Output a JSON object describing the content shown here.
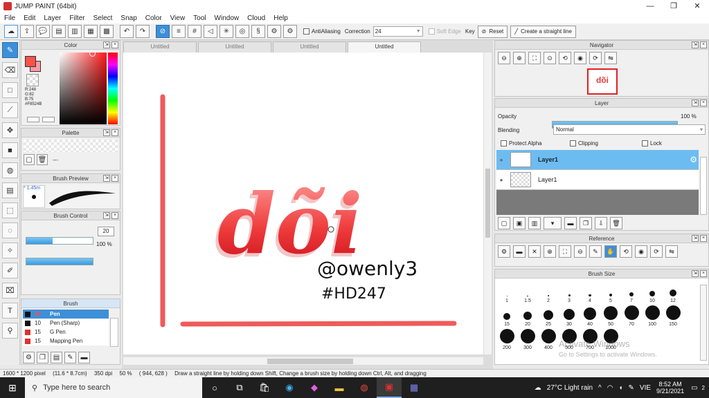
{
  "window": {
    "title": "JUMP PAINT (64bit)",
    "minimize": "—",
    "maximize": "❐",
    "close": "✕"
  },
  "menu": [
    "File",
    "Edit",
    "Layer",
    "Filter",
    "Select",
    "Snap",
    "Color",
    "View",
    "Tool",
    "Window",
    "Cloud",
    "Help"
  ],
  "toolbar": {
    "antialiasing_label": "AntiAliasing",
    "correction_label": "Correction",
    "correction_value": "24",
    "softedge_label": "Soft Edge",
    "key_label": "Key",
    "reset_label": "Reset",
    "straight_line_label": "Create a straight line"
  },
  "color_panel": {
    "title": "Color",
    "r": "R:248",
    "g": "G:82",
    "b": "B:75",
    "hex": "#F8524B",
    "accent": "#f8524b"
  },
  "palette_panel": {
    "title": "Palette",
    "dash": "---"
  },
  "brush_preview_panel": {
    "title": "Brush Preview",
    "size_label": "* 1.45m"
  },
  "brush_control_panel": {
    "title": "Brush Control",
    "size_value": "20",
    "opacity_value": "100 %",
    "size_fraction": 0.4,
    "opacity_fraction": 1.0
  },
  "brush_panel": {
    "title": "Brush",
    "items": [
      {
        "size": "20",
        "name": "Pen",
        "selected": true
      },
      {
        "size": "10",
        "name": "Pen (Sharp)",
        "selected": false
      },
      {
        "size": "15",
        "name": "G Pen",
        "selected": false
      },
      {
        "size": "15",
        "name": "Mapping Pen",
        "selected": false
      }
    ]
  },
  "doc_tabs": [
    "Untitled",
    "Untitled",
    "Untitled",
    "Untitled"
  ],
  "artwork": {
    "word": "dõi",
    "handle": "@owenly3",
    "tag": "#HD247",
    "stroke_color": "#f05050"
  },
  "navigator_panel": {
    "title": "Navigator"
  },
  "layer_panel": {
    "title": "Layer",
    "opacity_label": "Opacity",
    "opacity_value": "100 %",
    "opacity_fraction": 1.0,
    "blending_label": "Blending",
    "blending_value": "Normal",
    "protect_alpha_label": "Protect Alpha",
    "clipping_label": "Clipping",
    "lock_label": "Lock",
    "layers": [
      {
        "name": "Layer1",
        "selected": true
      },
      {
        "name": "Layer1",
        "selected": false
      }
    ]
  },
  "reference_panel": {
    "title": "Reference"
  },
  "brush_size_panel": {
    "title": "Brush Size",
    "sizes": [
      "1",
      "1.5",
      "2",
      "3",
      "4",
      "5",
      "7",
      "10",
      "12",
      "15",
      "20",
      "25",
      "30",
      "40",
      "50",
      "70",
      "100",
      "150",
      "200",
      "300",
      "400",
      "500",
      "700",
      "1000"
    ],
    "watermark_1": "Activate Windows",
    "watermark_2": "Go to Settings to activate Windows."
  },
  "status": {
    "dimensions": "1600 * 1200 pixel",
    "physical": "(11.6 * 8.7cm)",
    "dpi": "350 dpi",
    "zoom": "50 %",
    "cursor": "( 944, 628 )",
    "hint": "Draw a straight line by holding down Shift, Change a brush size by holding down Ctrl, Alt, and dragging"
  },
  "taskbar": {
    "search_placeholder": "Type here to search",
    "weather": "27°C  Light rain",
    "lang": "VIE",
    "time": "8:52 AM",
    "date": "9/21/2021",
    "notifications": "2"
  }
}
